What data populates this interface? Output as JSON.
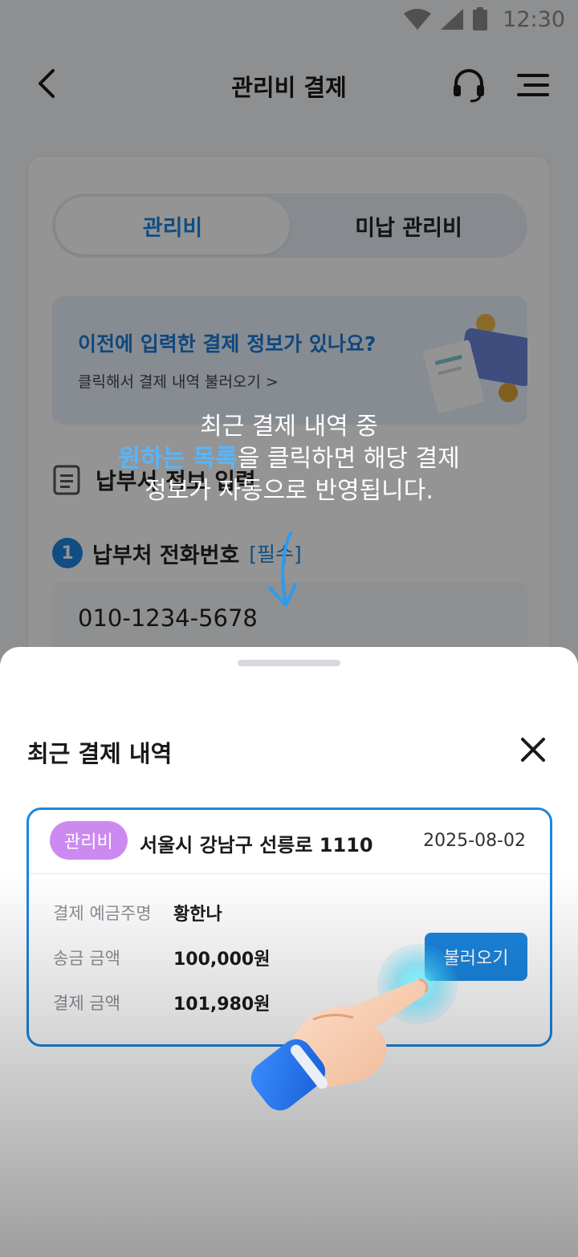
{
  "status_bar": {
    "time": "12:30",
    "icons": [
      "wifi-icon",
      "signal-icon",
      "battery-icon"
    ]
  },
  "header": {
    "title": "관리비 결제",
    "icons": [
      "back-icon",
      "headset-icon",
      "menu-icon"
    ]
  },
  "tabs": {
    "active": "관리비",
    "inactive": "미납 관리비"
  },
  "banner": {
    "title": "이전에 입력한 결제 정보가 있나요?",
    "subtitle": "클릭해서 결제 내역 불러오기 >"
  },
  "section": {
    "title": "납부서 정보 입력"
  },
  "field": {
    "step": "1",
    "label": "납부처 전화번호",
    "required": "[필수]",
    "value": "010-1234-5678"
  },
  "coach": {
    "line1": "최근 결제 내역 중",
    "line2_highlight": "원하는 목록",
    "line2_rest": "을 클릭하면 해당 결제",
    "line3": "정보가 자동으로 반영됩니다."
  },
  "sheet": {
    "title": "최근 결제 내역",
    "history": [
      {
        "tag": "관리비",
        "address": "서울시 강남구 선릉로 1110",
        "date": "2025-08-02",
        "rows": [
          {
            "label": "결제 예금주명",
            "value": "황한나"
          },
          {
            "label": "송금 금액",
            "value": "100,000원"
          },
          {
            "label": "결제 금액",
            "value": "101,980원"
          }
        ],
        "button": "불러오기"
      }
    ]
  },
  "colors": {
    "accent": "#1b86e0",
    "tag": "#cc8af0",
    "highlight": "#56b6ff"
  }
}
